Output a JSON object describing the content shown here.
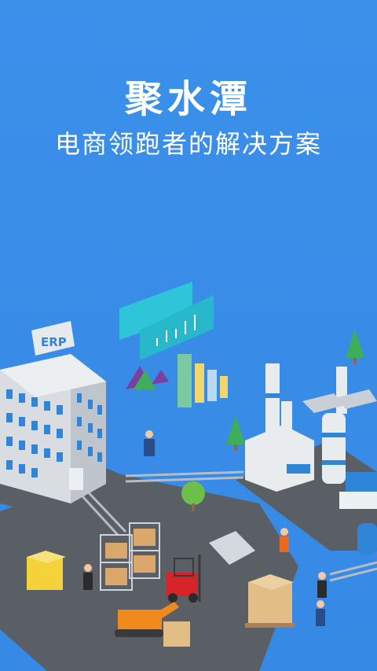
{
  "app": {
    "title": "聚水潭",
    "subtitle": "电商领跑者的解决方案"
  },
  "illustration": {
    "building_sign": "ERP",
    "colors": {
      "background": "#3a8fe8",
      "ground": "#5a5f66",
      "building": "#d9dde2",
      "window": "#2f86d8",
      "board": "#2ec5d9",
      "forklift": "#d8232a",
      "excavator": "#f08a1c",
      "box": "#f4d23a",
      "tree": "#3fae5a"
    }
  }
}
